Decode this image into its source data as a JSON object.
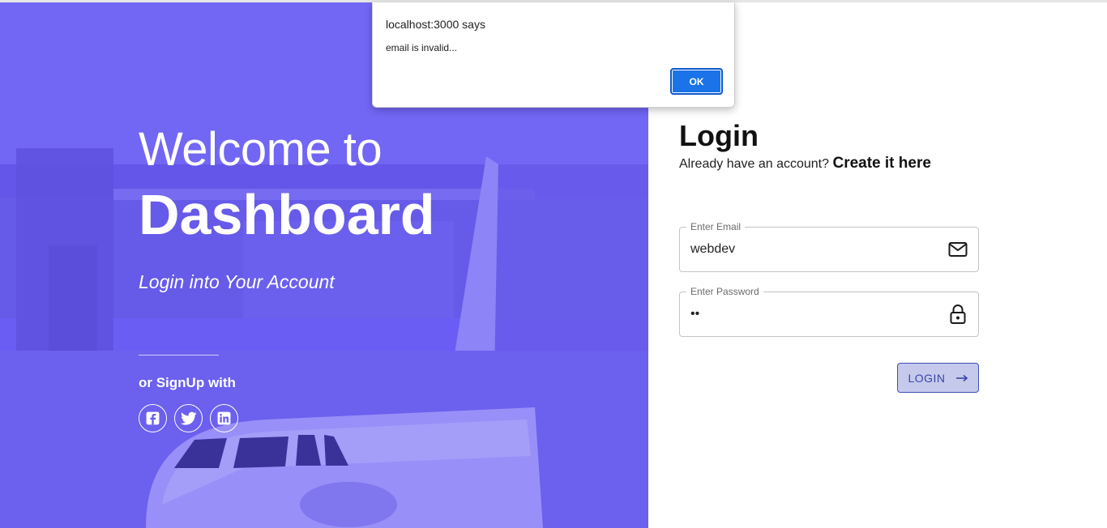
{
  "hero": {
    "welcome": "Welcome to",
    "brand": "Dashboard",
    "subtitle": "Login into Your Account",
    "signup_label": "or SignUp with",
    "social": [
      "facebook-icon",
      "twitter-icon",
      "linkedin-icon"
    ],
    "overlay_color": "#6a5df4"
  },
  "login": {
    "title": "Login",
    "account_prompt": "Already have an account?",
    "create_link": "Create it here",
    "email": {
      "label": "Enter Email",
      "value": "webdev",
      "icon": "mail-icon"
    },
    "password": {
      "label": "Enter Password",
      "value": "••",
      "icon": "lock-icon"
    },
    "submit": {
      "label": "LOGIN",
      "icon": "arrow-right-icon"
    },
    "accent_color": "#3f4fb8"
  },
  "alert": {
    "title": "localhost:3000 says",
    "message": "email is invalid...",
    "ok_label": "OK",
    "button_color": "#1a73e8"
  }
}
